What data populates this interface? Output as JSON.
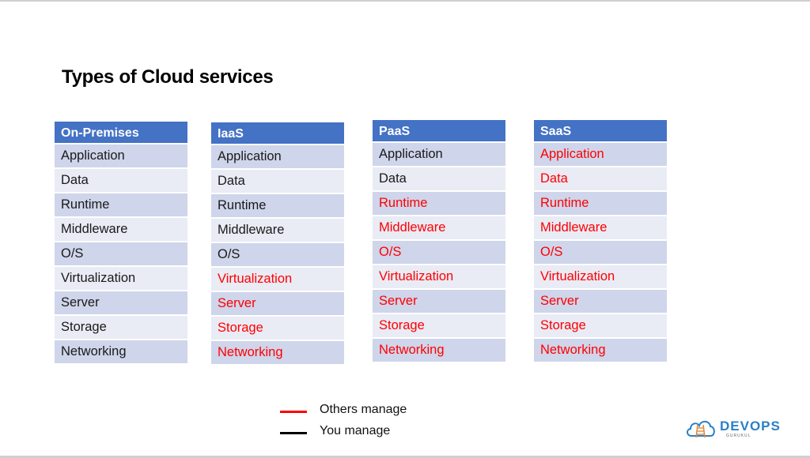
{
  "slide": {
    "title": "Types of Cloud services"
  },
  "colors": {
    "header_bg": "#4472c4",
    "row_odd": "#cfd5ea",
    "row_even": "#e9ebf5",
    "others_manage": "#ff0000",
    "you_manage": "#000000"
  },
  "tables": [
    {
      "header": "On-Premises",
      "rows": [
        {
          "label": "Application",
          "managed_by": "you"
        },
        {
          "label": "Data",
          "managed_by": "you"
        },
        {
          "label": "Runtime",
          "managed_by": "you"
        },
        {
          "label": "Middleware",
          "managed_by": "you"
        },
        {
          "label": "O/S",
          "managed_by": "you"
        },
        {
          "label": "Virtualization",
          "managed_by": "you"
        },
        {
          "label": "Server",
          "managed_by": "you"
        },
        {
          "label": "Storage",
          "managed_by": "you"
        },
        {
          "label": "Networking",
          "managed_by": "you"
        }
      ]
    },
    {
      "header": "IaaS",
      "rows": [
        {
          "label": "Application",
          "managed_by": "you"
        },
        {
          "label": "Data",
          "managed_by": "you"
        },
        {
          "label": "Runtime",
          "managed_by": "you"
        },
        {
          "label": "Middleware",
          "managed_by": "you"
        },
        {
          "label": "O/S",
          "managed_by": "you"
        },
        {
          "label": "Virtualization",
          "managed_by": "others"
        },
        {
          "label": "Server",
          "managed_by": "others"
        },
        {
          "label": "Storage",
          "managed_by": "others"
        },
        {
          "label": "Networking",
          "managed_by": "others"
        }
      ]
    },
    {
      "header": "PaaS",
      "rows": [
        {
          "label": "Application",
          "managed_by": "you"
        },
        {
          "label": "Data",
          "managed_by": "you"
        },
        {
          "label": "Runtime",
          "managed_by": "others"
        },
        {
          "label": "Middleware",
          "managed_by": "others"
        },
        {
          "label": "O/S",
          "managed_by": "others"
        },
        {
          "label": "Virtualization",
          "managed_by": "others"
        },
        {
          "label": "Server",
          "managed_by": "others"
        },
        {
          "label": "Storage",
          "managed_by": "others"
        },
        {
          "label": "Networking",
          "managed_by": "others"
        }
      ]
    },
    {
      "header": "SaaS",
      "rows": [
        {
          "label": "Application",
          "managed_by": "others"
        },
        {
          "label": "Data",
          "managed_by": "others"
        },
        {
          "label": "Runtime",
          "managed_by": "others"
        },
        {
          "label": "Middleware",
          "managed_by": "others"
        },
        {
          "label": "O/S",
          "managed_by": "others"
        },
        {
          "label": "Virtualization",
          "managed_by": "others"
        },
        {
          "label": "Server",
          "managed_by": "others"
        },
        {
          "label": "Storage",
          "managed_by": "others"
        },
        {
          "label": "Networking",
          "managed_by": "others"
        }
      ]
    }
  ],
  "legend": [
    {
      "label": "Others manage",
      "color": "#ff0000"
    },
    {
      "label": "You manage",
      "color": "#000000"
    }
  ],
  "logo": {
    "name": "DEVOPS",
    "subtitle": "GURUKUL"
  }
}
